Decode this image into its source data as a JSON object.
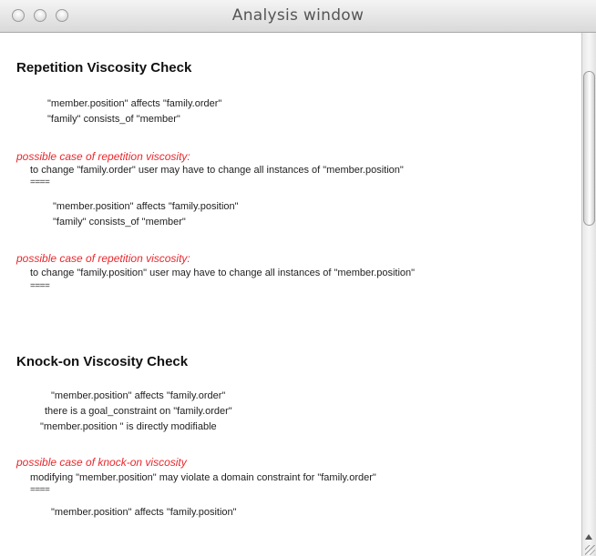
{
  "window": {
    "title": "Analysis window"
  },
  "sections": {
    "repetition": {
      "title": "Repetition Viscosity Check",
      "block1": [
        "\"member.position\" affects \"family.order\"",
        "\"family\" consists_of \"member\""
      ],
      "warning1": "possible case of repetition viscosity:",
      "message1": "to change \"family.order\" user may have to change  all instances of \"member.position\"",
      "sep1": "====",
      "block2": [
        "\"member.position\" affects \"family.position\"",
        "\"family\" consists_of \"member\""
      ],
      "warning2": "possible case of repetition viscosity:",
      "message2": "to change \"family.position\" user may have to change  all instances of \"member.position\"",
      "sep2": "===="
    },
    "knockon": {
      "title": "Knock-on Viscosity Check",
      "block1": [
        "\"member.position\" affects \"family.order\"",
        "there is a goal_constraint on \"family.order\"",
        "\"member.position \" is directly modifiable"
      ],
      "warning1": "possible case of knock-on viscosity",
      "message1": "modifying \"member.position\" may violate a domain constraint for \"family.order\"",
      "sep1": "====",
      "block2": [
        "\"member.position\" affects \"family.position\""
      ]
    }
  }
}
